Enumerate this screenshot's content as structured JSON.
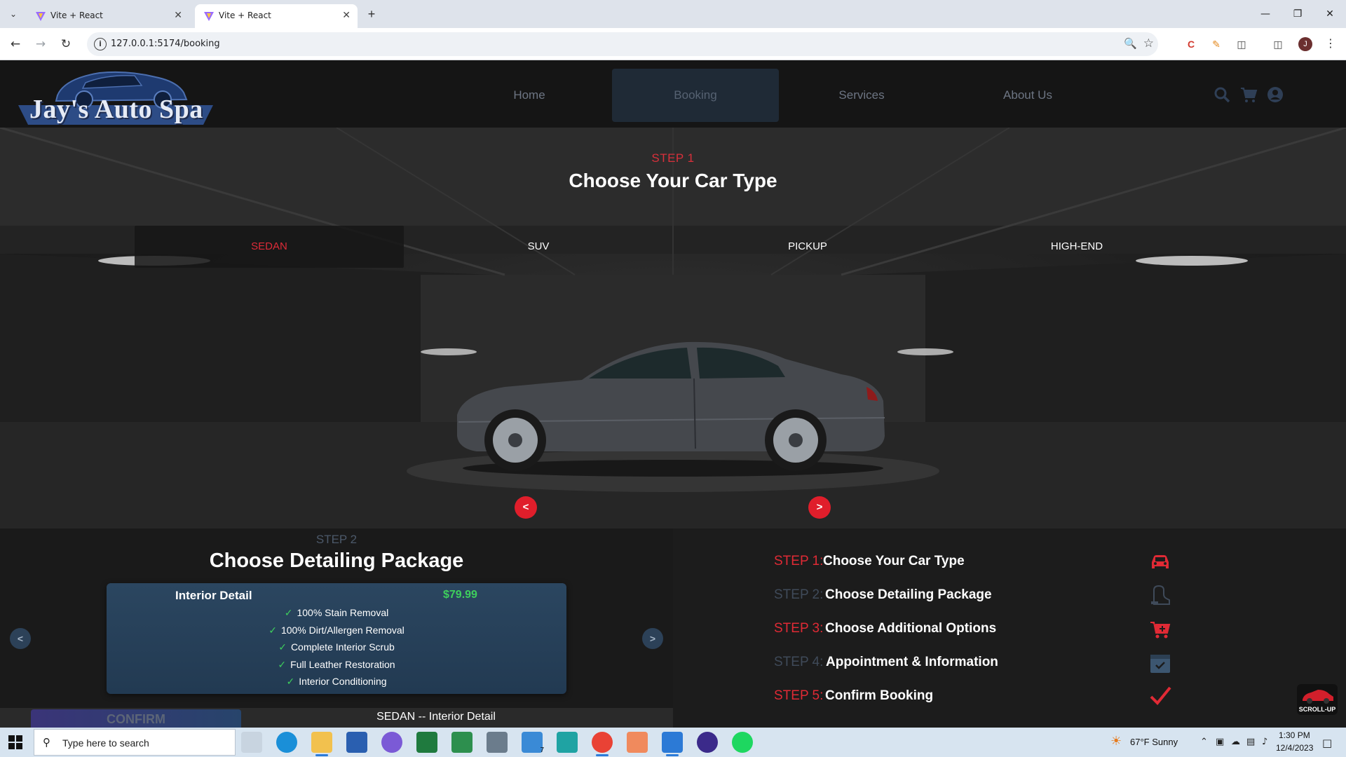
{
  "browser": {
    "tabs": [
      {
        "title": "Vite + React",
        "active": false
      },
      {
        "title": "Vite + React",
        "active": true
      }
    ],
    "url": "127.0.0.1:5174/booking",
    "profile_initial": "J"
  },
  "site": {
    "logo_text": "Jay's Auto Spa",
    "nav": [
      "Home",
      "Booking",
      "Services",
      "About Us"
    ],
    "active_nav": "Booking"
  },
  "step1": {
    "label": "STEP 1",
    "title": "Choose Your Car Type",
    "car_types": [
      "SEDAN",
      "SUV",
      "PICKUP",
      "HIGH-END"
    ],
    "selected": "SEDAN"
  },
  "step2": {
    "label": "STEP 2",
    "title": "Choose Detailing Package",
    "package": {
      "name": "Interior Detail",
      "price": "$79.99",
      "features": [
        "100% Stain Removal",
        "100% Dirt/Allergen Removal",
        "Complete Interior Scrub",
        "Full Leather Restoration",
        "Interior Conditioning"
      ]
    },
    "confirm_label": "CONFIRM",
    "summary": "SEDAN -- Interior Detail"
  },
  "steps": [
    {
      "label": "STEP 1:",
      "title": "Choose Your Car Type",
      "icon": "car-icon",
      "active": true
    },
    {
      "label": "STEP 2:",
      "title": "Choose Detailing Package",
      "icon": "vacuum-icon",
      "active": false
    },
    {
      "label": "STEP 3:",
      "title": "Choose Additional Options",
      "icon": "cart-add-icon",
      "active": true
    },
    {
      "label": "STEP 4:",
      "title": "Appointment & Information",
      "icon": "calendar-check-icon",
      "active": false
    },
    {
      "label": "STEP 5:",
      "title": "Confirm Booking",
      "icon": "checkmark-icon",
      "active": true
    }
  ],
  "scroll_up_label": "SCROLL-UP",
  "taskbar": {
    "search_placeholder": "Type here to search",
    "weather": "67°F  Sunny",
    "time": "1:30 PM",
    "date": "12/4/2023",
    "mail_badge": "7"
  },
  "colors": {
    "accent_red": "#e02a35",
    "price_green": "#3ecf5c",
    "card_blue": "#2b4660"
  }
}
